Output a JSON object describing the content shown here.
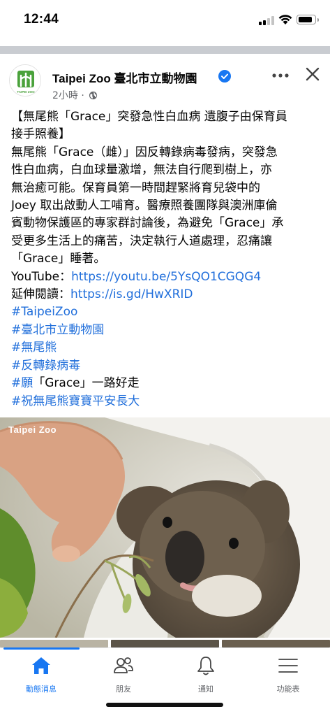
{
  "status_bar": {
    "time": "12:44"
  },
  "post": {
    "page_name": "Taipei Zoo 臺北市立動物園",
    "avatar_text": "TAIPEI ZOO",
    "timestamp": "2小時",
    "separator": "·",
    "text_lines": [
      "【無尾熊「Grace」突發急性白血病 遺腹子由保育員",
      "接手照養】",
      "無尾熊「Grace（雌）」因反轉錄病毒發病，突發急",
      "性白血病，白血球量激增，無法自行爬到樹上，亦",
      "無治癒可能。保育員第一時間趕緊將育兒袋中的",
      "Joey 取出啟動人工哺育。醫療照養團隊與澳洲庫倫",
      "賓動物保護區的專家群討論後，為避免「Grace」承",
      "受更多生活上的痛苦，決定執行人道處理，忍痛讓",
      "「Grace」睡著。"
    ],
    "youtube_label": "YouTube：",
    "youtube_link": "https://youtu.be/5YsQO1CGQG4",
    "extended_label": "延伸閱讀：",
    "extended_link": "https://is.gd/HwXRID",
    "hashtags": [
      "#TaipeiZoo",
      "#臺北市立動物園",
      "#無尾熊",
      "#反轉錄病毒"
    ],
    "hashtag_wish_tag": "#願",
    "hashtag_wish_rest": "「Grace」一路好走",
    "hashtag_last": "#祝無尾熊寶寶平安長大",
    "photo_watermark": "Taipei Zoo"
  },
  "nav": {
    "items": [
      {
        "label": "動態消息",
        "icon": "home-icon"
      },
      {
        "label": "朋友",
        "icon": "friends-icon"
      },
      {
        "label": "通知",
        "icon": "bell-icon"
      },
      {
        "label": "功能表",
        "icon": "menu-icon"
      }
    ]
  },
  "colors": {
    "link": "#216fdb",
    "accent": "#1877f2",
    "secondary_text": "#65676b",
    "divider": "#c9ccd1"
  }
}
